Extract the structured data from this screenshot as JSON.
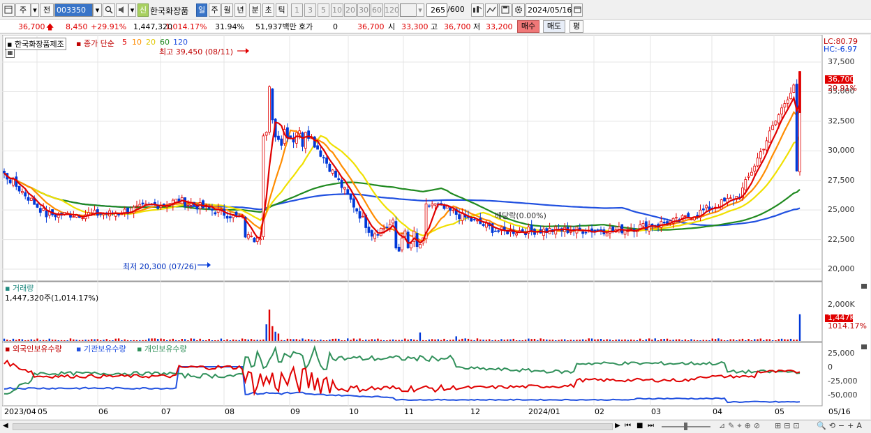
{
  "toolbar": {
    "market_label": "주",
    "prev_label": "전",
    "code_value": "003350",
    "new_badge": "신",
    "stock_name": "한국화장품",
    "period_tabs": [
      "일",
      "주",
      "월",
      "년",
      "분",
      "초",
      "틱"
    ],
    "interval_buttons": [
      "1",
      "3",
      "5",
      "10",
      "20",
      "30",
      "60",
      "120"
    ],
    "count_value": "265",
    "count_total": "/600",
    "date_value": "2024/05/16"
  },
  "quote": {
    "price": "36,700",
    "change": "8,450",
    "change_pct": "+29.91%",
    "volume": "1,447,320",
    "volume_ratio": "1,014.17%",
    "turnover": "31.94%",
    "amount": "51,937백만",
    "hoga_label": "호가",
    "hoga_value": "0",
    "hoga_price": "36,700",
    "open_label": "시",
    "open": "33,300",
    "high_label": "고",
    "high": "36,700",
    "low_label": "저",
    "low": "33,200",
    "buy_label": "매수",
    "sell_label": "매도",
    "eval_label": "평"
  },
  "price_panel": {
    "name_label": "한국화장품제조",
    "ma_title": "종가 단순",
    "ma_periods": [
      "5",
      "10",
      "20",
      "60",
      "120"
    ],
    "high_annot": "최고 39,450 (08/11)",
    "low_annot": "최저 20,300 (07/26)",
    "dividend_annot": "배당락(0.00%)",
    "lc_label": "LC:80.79",
    "hc_label": "HC:-6.97",
    "current_price_tag": "36,700",
    "current_pct_tag": "29.91%"
  },
  "volume_panel": {
    "title": "거래량",
    "value": "1,447,320주(1,014.17%)",
    "current_tag": "1,447K",
    "current_pct": "1014.17%"
  },
  "holdings_panel": {
    "legend": [
      "외국인보유수량",
      "기관보유수량",
      "개인보유수량"
    ]
  },
  "colors": {
    "ma5": "#e00000",
    "ma10": "#ff8c00",
    "ma20": "#f0e000",
    "ma60": "#208a20",
    "ma120": "#2050e0",
    "up": "#e00000",
    "down": "#0038d8",
    "foreign": "#e00000",
    "institution": "#2050e0",
    "individual": "#30905a"
  },
  "chart_data": [
    {
      "type": "candlestick",
      "title": "한국화장품제조",
      "x_ticks": [
        "2023/04",
        "05",
        "06",
        "07",
        "08",
        "09",
        "10",
        "11",
        "12",
        "2024/01",
        "02",
        "03",
        "04",
        "05",
        "05/16"
      ],
      "y_ticks": [
        "37,500",
        "35,000",
        "32,500",
        "30,000",
        "27,500",
        "25,000",
        "22,500",
        "20,000"
      ],
      "ylim": [
        19000,
        39800
      ],
      "approx_close": {
        "x": [
          "2023-04",
          "2023-05",
          "2023-06",
          "2023-07",
          "2023-08",
          "2023-09",
          "2023-10",
          "2023-11",
          "2023-12",
          "2024-01",
          "2024-02",
          "2024-03",
          "2024-04",
          "2024-05-16"
        ],
        "y": [
          28000,
          24500,
          24800,
          26000,
          31500,
          31800,
          23000,
          25500,
          23000,
          23300,
          23300,
          24000,
          26000,
          36700
        ]
      }
    },
    {
      "type": "bar",
      "title": "거래량",
      "y_ticks": [
        "2,000K",
        "0"
      ],
      "last_value": "1,447K"
    },
    {
      "type": "line",
      "series": [
        {
          "name": "외국인보유수량"
        },
        {
          "name": "기관보유수량"
        },
        {
          "name": "개인보유수량"
        }
      ],
      "y_ticks": [
        "25,000",
        "0",
        "-25,000",
        "-50,000"
      ]
    }
  ]
}
